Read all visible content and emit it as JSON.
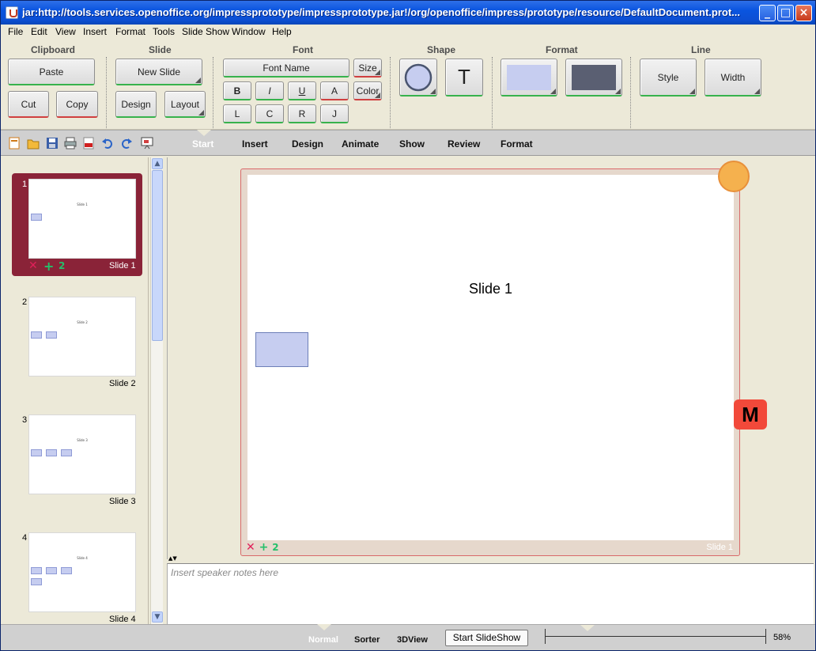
{
  "window": {
    "title": "jar:http://tools.services.openoffice.org/impressprototype/impressprototype.jar!/org/openoffice/impress/prototype/resource/DefaultDocument.prot...",
    "minimize": "_",
    "maximize": "□",
    "close": "×"
  },
  "menu": [
    "File",
    "Edit",
    "View",
    "Insert",
    "Format",
    "Tools",
    "Slide Show",
    "Window",
    "Help"
  ],
  "ribbon": {
    "clipboard": {
      "label": "Clipboard",
      "paste": "Paste",
      "cut": "Cut",
      "copy": "Copy"
    },
    "slide": {
      "label": "Slide",
      "new_slide": "New Slide",
      "design": "Design",
      "layout": "Layout"
    },
    "font": {
      "label": "Font",
      "font_name": "Font Name",
      "size": "Size",
      "bold": "B",
      "italic": "I",
      "underline": "U",
      "a": "A",
      "color": "Color",
      "l": "L",
      "c": "C",
      "r": "R",
      "j": "J"
    },
    "shape": {
      "label": "Shape",
      "text_tool": "T"
    },
    "format": {
      "label": "Format"
    },
    "line": {
      "label": "Line",
      "style": "Style",
      "width": "Width"
    }
  },
  "tabs": [
    "Start",
    "Insert",
    "Design",
    "Animate",
    "Show",
    "Review",
    "Format"
  ],
  "active_tab": "Start",
  "slides": [
    {
      "num": "1",
      "label": "Slide 1",
      "title": "Slide 1",
      "boxes": 1,
      "selected": true,
      "delete": "✕",
      "add": "+",
      "count": "2"
    },
    {
      "num": "2",
      "label": "Slide 2",
      "title": "Slide 2",
      "boxes": 2
    },
    {
      "num": "3",
      "label": "Slide 3",
      "title": "Slide 3",
      "boxes": 3
    },
    {
      "num": "4",
      "label": "Slide 4",
      "title": "Slide 4",
      "boxes": 4
    }
  ],
  "editor": {
    "slide_title": "Slide 1",
    "frame_delete": "✕",
    "frame_add": "+",
    "frame_count": "2",
    "frame_label": "Slide 1",
    "m_badge": "M"
  },
  "notes": {
    "placeholder": "Insert speaker notes here"
  },
  "status": {
    "views": [
      "Normal",
      "Sorter",
      "3DView"
    ],
    "active_view": "Normal",
    "start_show": "Start SlideShow",
    "zoom": "58%"
  },
  "colors": {
    "selected_thumb": "#8a2338",
    "shape_fill": "#c6cdf0",
    "format_light": "#c6cdf0",
    "format_dark": "#5a5f72",
    "m_badge": "#f2493a",
    "orange_marker": "#f5b14e"
  }
}
